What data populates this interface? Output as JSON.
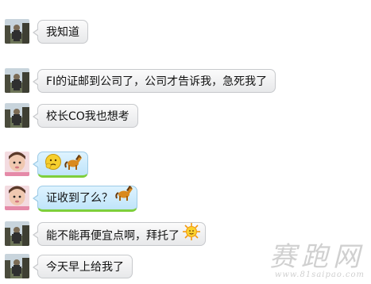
{
  "messages": [
    {
      "sender": "contact",
      "text": "我知道"
    },
    {
      "sender": "contact",
      "text": "FI的证邮到公司了，公司才告诉我，急死我了"
    },
    {
      "sender": "contact",
      "text": "校长CO我也想考"
    },
    {
      "sender": "self",
      "emoticons": [
        "thinking-emoticon",
        "pony-emoticon"
      ]
    },
    {
      "sender": "self",
      "text": "证收到了么？",
      "emoticons": [
        "pony-emoticon"
      ]
    },
    {
      "sender": "contact",
      "text": "能不能再便宜点啊，拜托了",
      "emoticons": [
        "sun-emoticon"
      ]
    },
    {
      "sender": "contact",
      "text": "今天早上给我了"
    }
  ],
  "watermark": {
    "logo_text": "赛跑网",
    "url": "www.81saipao.com"
  },
  "colors": {
    "contact_bubble": "#ededee",
    "self_bubble": "#cbe9fb",
    "self_bubble_accent": "#7ecf3b",
    "watermark": "#aaaaaa"
  }
}
